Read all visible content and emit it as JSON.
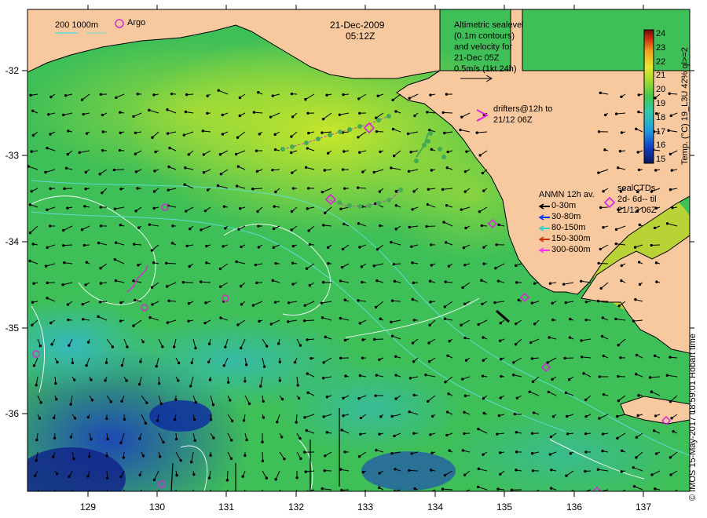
{
  "map": {
    "date": "21-Dec-2009",
    "time": "05:12Z",
    "x_ticks": [
      "129",
      "130",
      "131",
      "132",
      "133",
      "134",
      "135",
      "136",
      "137"
    ],
    "y_ticks": [
      "-32",
      "-33",
      "-34",
      "-35",
      "-36"
    ],
    "land_color": "#f8c89e"
  },
  "legend": {
    "bathy": "200  1000m",
    "argo": "Argo",
    "altimetry_lines": [
      "Altimetric sealevel",
      "(0.1m contours)",
      "and velocity for",
      "21-Dec 05Z",
      "0.5m/s (1kt 24h)"
    ],
    "drifters": [
      "drifters@12h to",
      "21/12 06Z"
    ],
    "anmn_title": "ANMN 12h av.",
    "anmn_items": [
      {
        "label": "0-30m",
        "color": "#000000"
      },
      {
        "label": "30-80m",
        "color": "#0033ff"
      },
      {
        "label": "80-150m",
        "color": "#33cccc"
      },
      {
        "label": "150-300m",
        "color": "#cc3300"
      },
      {
        "label": "300-600m",
        "color": "#ff33ff"
      }
    ],
    "sealctd": [
      "sealCTDs",
      "2d- 6d-- til",
      "21/12 06Z"
    ]
  },
  "colorbar": {
    "ticks": [
      "24",
      "23",
      "22",
      "21",
      "20",
      "19",
      "18",
      "17",
      "16",
      "15"
    ],
    "label": "Temp. (°C) 19_L3U 42% ql>=2"
  },
  "credit": "© IMOS 15-May-2017 18:59:01 Hobart time"
}
